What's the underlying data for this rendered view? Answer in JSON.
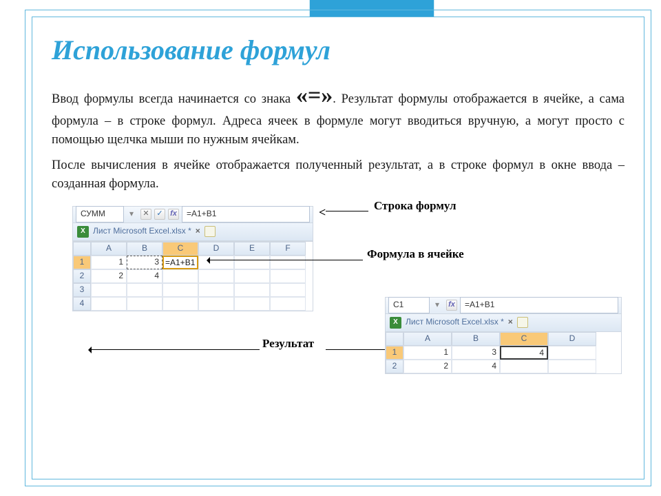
{
  "title": "Использование формул",
  "paragraphs": {
    "p1a": "Ввод формулы всегда начинается со знака ",
    "eq": "«=»",
    "p1b": ". Результат формулы отображается в ячейке, а сама формула – в строке формул. Адреса ячеек в формуле могут вводиться вручную, а могут просто с помощью щелчка мыши по нужным ячейкам.",
    "p2": "После вычисления в ячейке отображается полученный результат, а в строке формул в окне ввода – созданная формула."
  },
  "labels": {
    "formula_bar": "Строка формул",
    "formula_in_cell": "Формула в ячейке",
    "result": "Результат"
  },
  "excel1": {
    "namebox": "СУММ",
    "icon_x": "✕",
    "icon_check": "✓",
    "icon_fx": "fx",
    "formula": "=A1+B1",
    "tab_title": "Лист Microsoft Excel.xlsx *",
    "tab_close": "×",
    "cols": [
      "A",
      "B",
      "C",
      "D",
      "E",
      "F"
    ],
    "rows": {
      "r1": {
        "num": "1",
        "a": "1",
        "b": "3",
        "c": "=A1+B1"
      },
      "r2": {
        "num": "2",
        "a": "2",
        "b": "4"
      },
      "r3": {
        "num": "3"
      },
      "r4": {
        "num": "4"
      }
    }
  },
  "excel2": {
    "namebox": "C1",
    "icon_fx": "fx",
    "formula": "=A1+B1",
    "tab_title": "Лист Microsoft Excel.xlsx *",
    "tab_close": "×",
    "cols": [
      "A",
      "B",
      "C",
      "D"
    ],
    "rows": {
      "r1": {
        "num": "1",
        "a": "1",
        "b": "3",
        "c": "4"
      },
      "r2": {
        "num": "2",
        "a": "2",
        "b": "4"
      }
    }
  }
}
